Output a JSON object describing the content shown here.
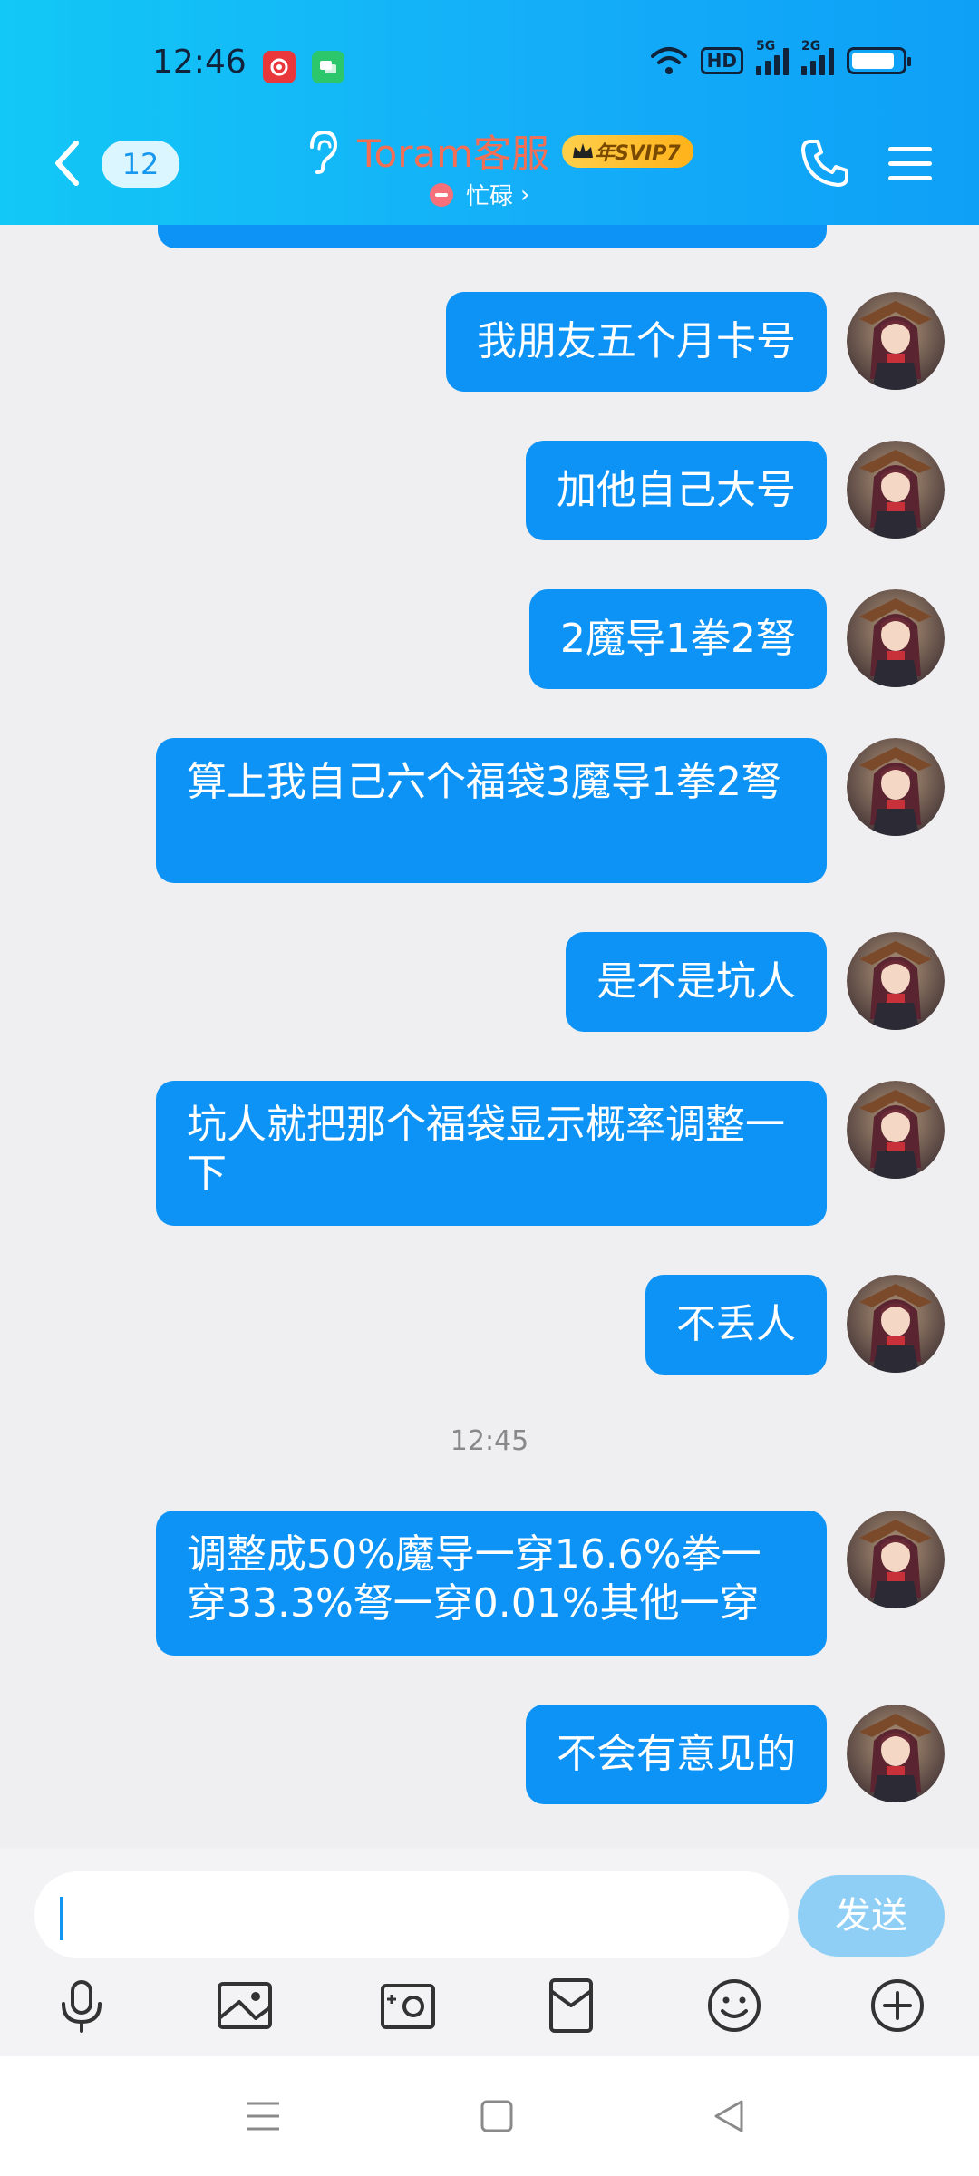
{
  "status_bar": {
    "time": "12:46",
    "hd_label": "HD",
    "network_1": "5G",
    "network_2": "2G",
    "battery_level": 0.85
  },
  "header": {
    "unread_count": "12",
    "contact_name": "Toram客服",
    "vip_badge": "年SVIP7",
    "presence_status": "忙碌",
    "presence_chevron": "›"
  },
  "messages": [
    {
      "text": "我朋友五个月卡号"
    },
    {
      "text": "加他自己大号"
    },
    {
      "text": "2魔导1拳2弩"
    },
    {
      "text": "算上我自己六个福袋3魔导1拳2弩"
    },
    {
      "text": "是不是坑人"
    },
    {
      "text": "坑人就把那个福袋显示概率调整一下"
    },
    {
      "text": "不丢人"
    },
    {
      "text": "调整成50%魔导一穿16.6%拳一穿33.3%弩一穿0.01%其他一穿"
    },
    {
      "text": "不会有意见的"
    }
  ],
  "timestamp": "12:45",
  "input": {
    "value": "",
    "send_label": "发送"
  },
  "toolbar": [
    "microphone-icon",
    "image-icon",
    "camera-icon",
    "red-packet-icon",
    "emoji-icon",
    "plus-icon"
  ],
  "colors": {
    "header_gradient_start": "#12c8f6",
    "header_gradient_end": "#0ea0f7",
    "bubble": "#0d93f6",
    "contact_name": "#f46e54",
    "send_button": "#8fcff6",
    "background": "#efeff1"
  }
}
